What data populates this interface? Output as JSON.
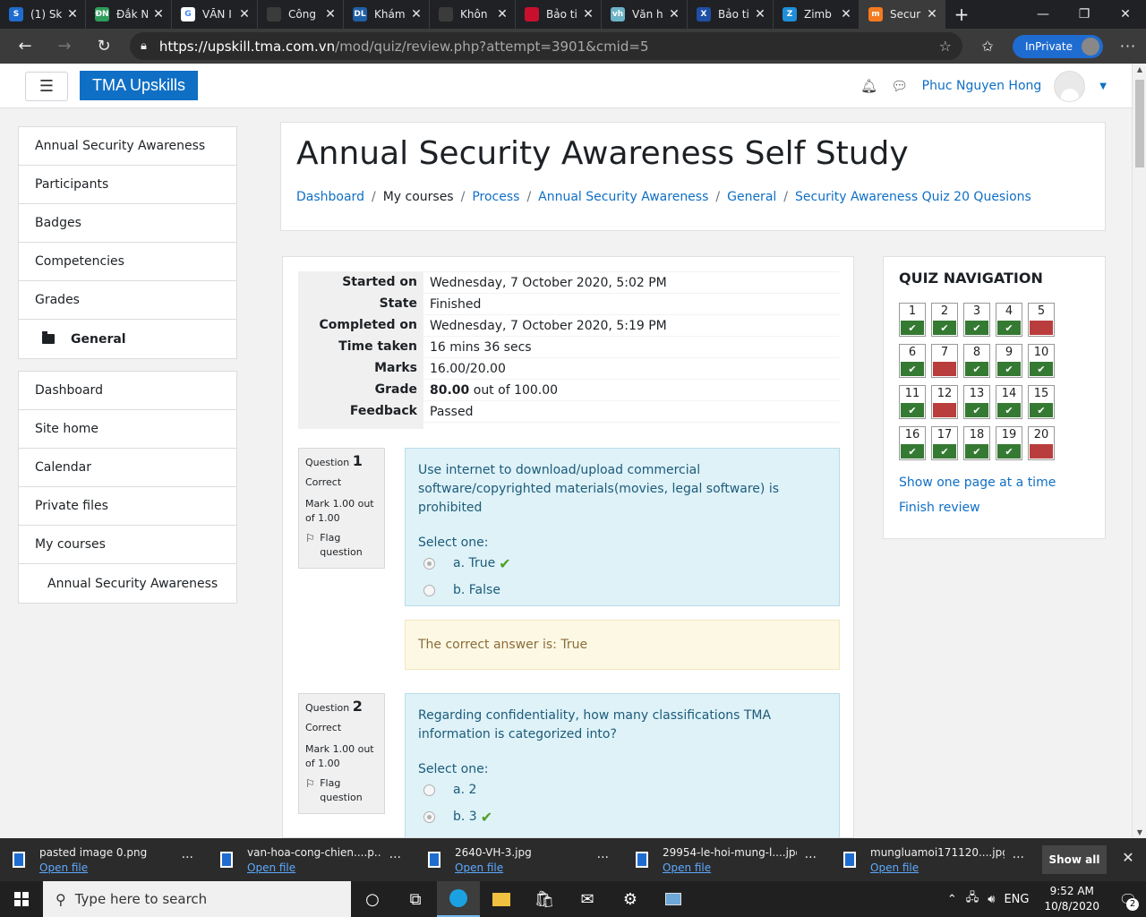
{
  "browser": {
    "tabs": [
      {
        "title": "(1) Sk",
        "fav_color": "#1f6cd1",
        "fav_text": "S",
        "icon": "skype-icon"
      },
      {
        "title": "Đắk N",
        "fav_color": "#2e9e5b",
        "fav_text": "ĐN",
        "icon": "news-icon"
      },
      {
        "title": "VĂN I",
        "fav_color": "#ffffff",
        "fav_text": "G",
        "icon": "google-icon"
      },
      {
        "title": "Công",
        "fav_color": "#3b3b3b",
        "fav_text": "",
        "icon": "page-icon"
      },
      {
        "title": "Khám",
        "fav_color": "#1f5fa6",
        "fav_text": "DL",
        "icon": "dl-icon"
      },
      {
        "title": "Khôn",
        "fav_color": "#3b3b3b",
        "fav_text": "",
        "icon": "page-icon"
      },
      {
        "title": "Bảo ti",
        "fav_color": "#c8102e",
        "fav_text": "",
        "icon": "news-icon"
      },
      {
        "title": "Văn h",
        "fav_color": "#6db3c7",
        "fav_text": "vh",
        "icon": "site-icon"
      },
      {
        "title": "Bảo ti",
        "fav_color": "#1f4fa6",
        "fav_text": "X",
        "icon": "x-icon"
      },
      {
        "title": "Zimb",
        "fav_color": "#1f8fd8",
        "fav_text": "Z",
        "icon": "zing-icon"
      },
      {
        "title": "Secur",
        "fav_color": "#f47a20",
        "fav_text": "m",
        "icon": "moodle-icon"
      }
    ],
    "url_host": "https://upskill.tma.com.vn",
    "url_path": "/mod/quiz/review.php?attempt=3901&cmid=5",
    "inprivate": "InPrivate"
  },
  "navbar": {
    "brand": "TMA Upskills",
    "user": "Phuc Nguyen Hong"
  },
  "sidebar": {
    "course": [
      {
        "label": "Annual Security Awareness"
      },
      {
        "label": "Participants"
      },
      {
        "label": "Badges"
      },
      {
        "label": "Competencies"
      },
      {
        "label": "Grades"
      },
      {
        "label": "General"
      }
    ],
    "site": [
      {
        "label": "Dashboard"
      },
      {
        "label": "Site home"
      },
      {
        "label": "Calendar"
      },
      {
        "label": "Private files"
      },
      {
        "label": "My courses"
      },
      {
        "label": "Annual Security Awareness"
      }
    ]
  },
  "page": {
    "title": "Annual Security Awareness Self Study",
    "breadcrumb": [
      "Dashboard",
      "My courses",
      "Process",
      "Annual Security Awareness",
      "General",
      "Security Awareness Quiz 20 Quesions"
    ]
  },
  "summary": {
    "started_label": "Started on",
    "started": "Wednesday, 7 October 2020, 5:02 PM",
    "state_label": "State",
    "state": "Finished",
    "completed_label": "Completed on",
    "completed": "Wednesday, 7 October 2020, 5:19 PM",
    "time_label": "Time taken",
    "time": "16 mins 36 secs",
    "marks_label": "Marks",
    "marks": "16.00/20.00",
    "grade_label": "Grade",
    "grade_value": "80.00",
    "grade_rest": " out of 100.00",
    "feedback_label": "Feedback",
    "feedback": "Passed"
  },
  "questions": [
    {
      "prefix": "Question ",
      "number": "1",
      "state": "Correct",
      "mark": "Mark 1.00 out of 1.00",
      "flag": "Flag question",
      "text": "Use internet to download/upload commercial software/copyrighted materials(movies, legal software) is prohibited",
      "prompt": "Select one:",
      "answers": [
        "a. True",
        "b. False"
      ],
      "correct": "The correct answer is: True"
    },
    {
      "prefix": "Question ",
      "number": "2",
      "state": "Correct",
      "mark": "Mark 1.00 out of 1.00",
      "flag": "Flag question",
      "text": "Regarding confidentiality, how many classifications TMA information is categorized into?",
      "prompt": "Select one:",
      "answers": [
        "a. 2",
        "b. 3"
      ]
    }
  ],
  "quiznav": {
    "title": "QUIZ NAVIGATION",
    "items": [
      {
        "n": "1",
        "status": "correct"
      },
      {
        "n": "2",
        "status": "correct"
      },
      {
        "n": "3",
        "status": "correct"
      },
      {
        "n": "4",
        "status": "correct"
      },
      {
        "n": "5",
        "status": "incorrect"
      },
      {
        "n": "6",
        "status": "correct"
      },
      {
        "n": "7",
        "status": "incorrect"
      },
      {
        "n": "8",
        "status": "correct"
      },
      {
        "n": "9",
        "status": "correct"
      },
      {
        "n": "10",
        "status": "correct"
      },
      {
        "n": "11",
        "status": "correct"
      },
      {
        "n": "12",
        "status": "incorrect"
      },
      {
        "n": "13",
        "status": "correct"
      },
      {
        "n": "14",
        "status": "correct"
      },
      {
        "n": "15",
        "status": "correct"
      },
      {
        "n": "16",
        "status": "correct"
      },
      {
        "n": "17",
        "status": "correct"
      },
      {
        "n": "18",
        "status": "correct"
      },
      {
        "n": "19",
        "status": "correct"
      },
      {
        "n": "20",
        "status": "incorrect"
      }
    ],
    "show_one_page": "Show one page at a time",
    "finish_review": "Finish review"
  },
  "downloads": {
    "items": [
      {
        "name": "pasted image 0.png",
        "action": "Open file"
      },
      {
        "name": "van-hoa-cong-chien....p...",
        "action": "Open file"
      },
      {
        "name": "2640-VH-3.jpg",
        "action": "Open file"
      },
      {
        "name": "29954-le-hoi-mung-l....jpg",
        "action": "Open file"
      },
      {
        "name": "mungluamoi171120....jpg",
        "action": "Open file"
      }
    ],
    "show_all": "Show all"
  },
  "taskbar": {
    "search_placeholder": "Type here to search",
    "lang": "ENG",
    "time": "9:52 AM",
    "date": "10/8/2020",
    "notifications": "2"
  },
  "colors": {
    "correct": "#357a32",
    "incorrect": "#ba3d3d",
    "brand": "#0f6fc5"
  }
}
